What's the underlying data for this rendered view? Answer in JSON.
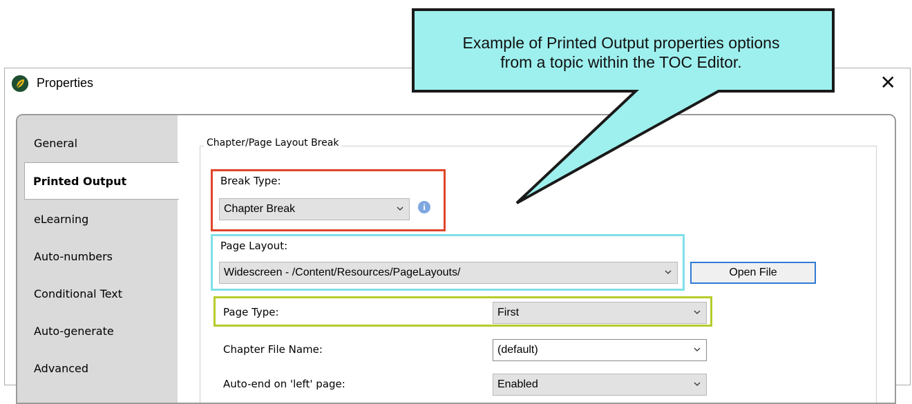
{
  "window": {
    "title": "Properties",
    "close_glyph": "✕"
  },
  "sidebar": {
    "items": [
      {
        "label": "General"
      },
      {
        "label": "Printed Output"
      },
      {
        "label": "eLearning"
      },
      {
        "label": "Auto-numbers"
      },
      {
        "label": "Conditional Text"
      },
      {
        "label": "Auto-generate"
      },
      {
        "label": "Advanced"
      }
    ]
  },
  "group": {
    "title": "Chapter/Page Layout Break"
  },
  "fields": {
    "break_type": {
      "label": "Break Type:",
      "value": "Chapter Break"
    },
    "page_layout": {
      "label": "Page Layout:",
      "value": "Widescreen - /Content/Resources/PageLayouts/"
    },
    "open_file_label": "Open File",
    "page_type": {
      "label": "Page Type:",
      "value": "First"
    },
    "chapter_file_name": {
      "label": "Chapter File Name:",
      "value": "(default)"
    },
    "auto_end": {
      "label": "Auto-end on 'left' page:",
      "value": "Enabled"
    }
  },
  "callout": {
    "line1": "Example of Printed Output properties options",
    "line2": "from a topic within the TOC Editor."
  },
  "colors": {
    "callout_fill": "#9ef0ee",
    "break_type_highlight": "#e0452b",
    "page_layout_highlight": "#7fe0e8",
    "page_type_highlight": "#b6cc2a",
    "button_border": "#2f7ad6"
  },
  "icons": [
    "app-logo-icon",
    "close-icon",
    "chevron-down-icon",
    "info-icon"
  ]
}
